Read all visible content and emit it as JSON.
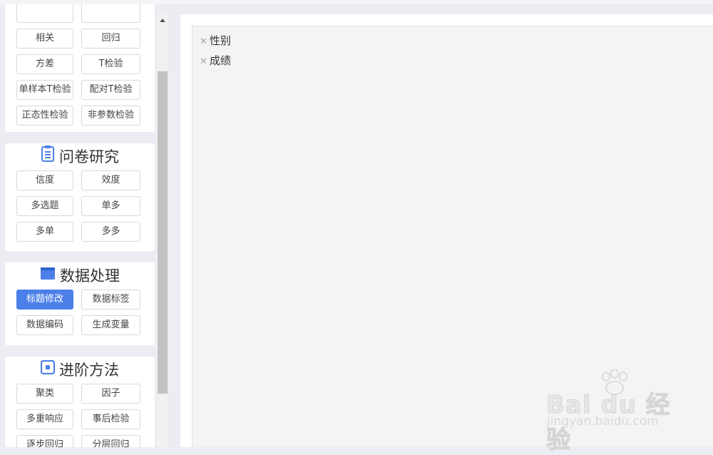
{
  "top_header_fragment": "",
  "sidebar": {
    "sections": [
      {
        "id": "basic",
        "buttons": [
          {
            "label": "",
            "col": 1,
            "row": 0
          },
          {
            "label": "",
            "col": 2,
            "row": 0
          },
          {
            "label": "相关",
            "col": 1,
            "row": 1
          },
          {
            "label": "回归",
            "col": 2,
            "row": 1
          },
          {
            "label": "方差",
            "col": 1,
            "row": 2
          },
          {
            "label": "T检验",
            "col": 2,
            "row": 2
          },
          {
            "label": "单样本T检验",
            "col": 1,
            "row": 3
          },
          {
            "label": "配对T检验",
            "col": 2,
            "row": 3
          },
          {
            "label": "正态性检验",
            "col": 1,
            "row": 4
          },
          {
            "label": "非参数检验",
            "col": 2,
            "row": 4
          }
        ]
      },
      {
        "id": "questionnaire",
        "title": "问卷研究",
        "icon": "clipboard-icon",
        "buttons": [
          "信度",
          "效度",
          "多选题",
          "单多",
          "多单",
          "多多"
        ]
      },
      {
        "id": "data-processing",
        "title": "数据处理",
        "icon": "folder-icon",
        "buttons": [
          "标题修改",
          "数据标签",
          "数据编码",
          "生成变量"
        ],
        "active": "标题修改"
      },
      {
        "id": "advanced",
        "title": "进阶方法",
        "icon": "target-icon",
        "buttons": [
          "聚类",
          "因子",
          "多重响应",
          "事后检验",
          "逐步回归",
          "分层回归"
        ]
      }
    ]
  },
  "variables": [
    {
      "name": "性别",
      "remove_icon": "close-icon"
    },
    {
      "name": "成绩",
      "remove_icon": "close-icon"
    }
  ],
  "watermark": {
    "logo_text": "Bai du 经验",
    "url": "jingyan.baidu.com"
  },
  "colors": {
    "accent": "#4c80e8",
    "background": "#ecedf2",
    "panel": "#ffffff",
    "variable_area": "#f4f4f4"
  }
}
